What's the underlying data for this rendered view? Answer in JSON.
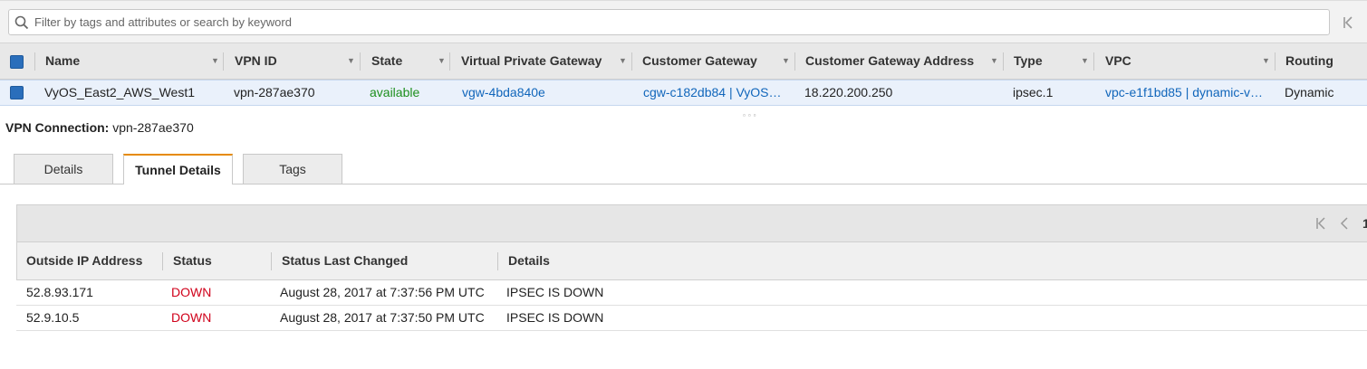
{
  "search": {
    "placeholder": "Filter by tags and attributes or search by keyword"
  },
  "grid": {
    "columns": [
      "Name",
      "VPN ID",
      "State",
      "Virtual Private Gateway",
      "Customer Gateway",
      "Customer Gateway Address",
      "Type",
      "VPC",
      "Routing"
    ],
    "row": {
      "name": "VyOS_East2_AWS_West1",
      "vpn_id": "vpn-287ae370",
      "state": "available",
      "vgw": "vgw-4bda840e",
      "cgw": "cgw-c182db84 | VyOS…",
      "cgw_address": "18.220.200.250",
      "type": "ipsec.1",
      "vpc": "vpc-e1f1bd85 | dynamic-v…",
      "routing": "Dynamic"
    }
  },
  "detail": {
    "label": "VPN Connection:",
    "value": "vpn-287ae370",
    "tabs": [
      "Details",
      "Tunnel Details",
      "Tags"
    ],
    "active_tab": "Tunnel Details"
  },
  "tunnels": {
    "pager_text": "1",
    "columns": [
      "Outside IP Address",
      "Status",
      "Status Last Changed",
      "Details"
    ],
    "rows": [
      {
        "ip": "52.8.93.171",
        "status": "DOWN",
        "changed": "August 28, 2017 at 7:37:56 PM UTC",
        "details": "IPSEC IS DOWN"
      },
      {
        "ip": "52.9.10.5",
        "status": "DOWN",
        "changed": "August 28, 2017 at 7:37:50 PM UTC",
        "details": "IPSEC IS DOWN"
      }
    ]
  },
  "colors": {
    "link": "#1166bb",
    "available": "#1d8f1d",
    "down": "#d0021b",
    "active_tab_accent": "#e68a00",
    "checkbox": "#2a6ebb"
  },
  "icons": {
    "search": "search-icon",
    "first_page": "first-page-icon",
    "prev_page": "prev-page-icon",
    "sort": "sort-desc-icon"
  }
}
